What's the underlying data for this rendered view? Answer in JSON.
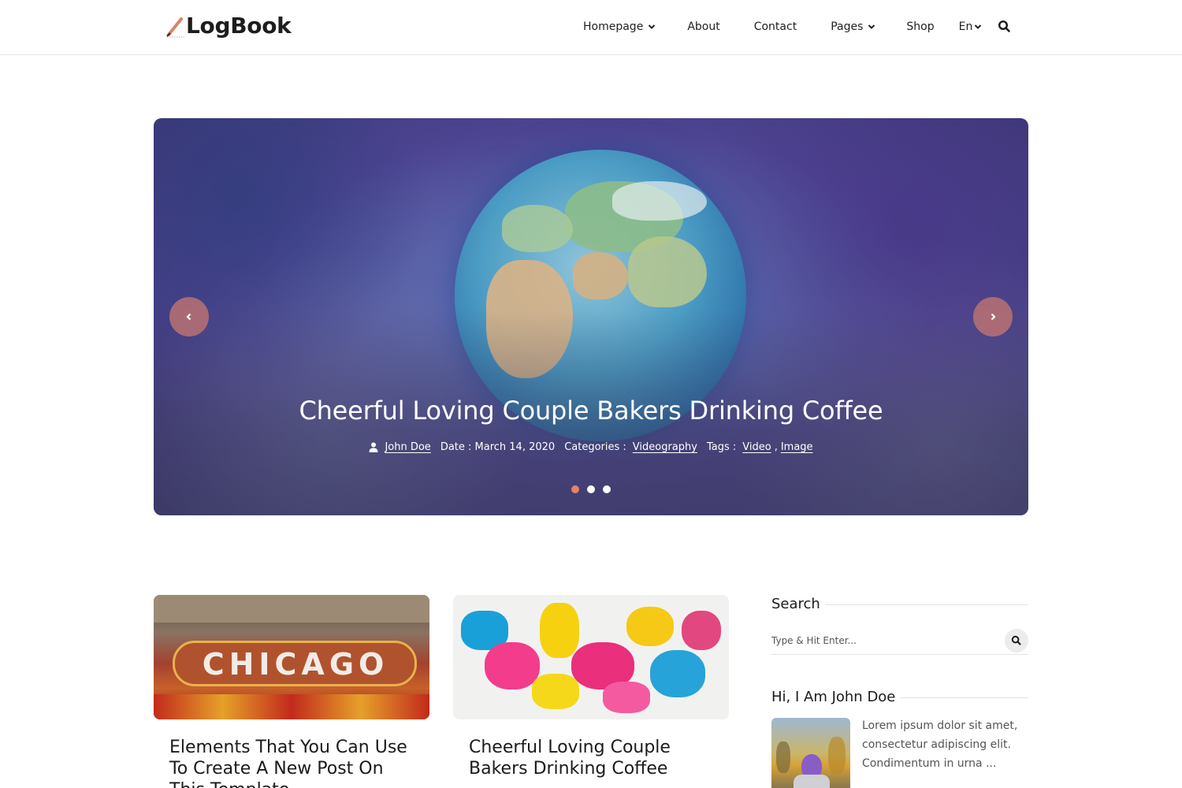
{
  "brand": {
    "name": "LogBook"
  },
  "nav": {
    "items": [
      {
        "label": "Homepage",
        "has_dropdown": true
      },
      {
        "label": "About",
        "has_dropdown": false
      },
      {
        "label": "Contact",
        "has_dropdown": false
      },
      {
        "label": "Pages",
        "has_dropdown": true
      },
      {
        "label": "Shop",
        "has_dropdown": false
      }
    ],
    "language": "En"
  },
  "hero": {
    "title": "Cheerful Loving Couple Bakers Drinking Coffee",
    "author": "John Doe",
    "date_label": "Date : March 14, 2020",
    "categories_label": "Categories :",
    "category": "Videography",
    "tags_label": "Tags :",
    "tags": [
      "Video",
      "Image"
    ],
    "tag_separator": ",",
    "slide_count": 3,
    "active_slide": 0
  },
  "posts": [
    {
      "title": "Elements That You Can Use To Create A New Post On This Template",
      "image": "chicago-theatre-sign"
    },
    {
      "title": "Cheerful Loving Couple Bakers Drinking Coffee",
      "image": "abstract-paint"
    }
  ],
  "sidebar": {
    "search": {
      "heading": "Search",
      "placeholder": "Type & Hit Enter..."
    },
    "about": {
      "heading": "Hi, I Am John Doe",
      "text": "Lorem ipsum dolor sit amet, consectetur adipiscing elit. Condimentum in urna ..."
    }
  },
  "colors": {
    "accent": "#e5826a",
    "text": "#1b1b1b",
    "muted": "#555555"
  }
}
